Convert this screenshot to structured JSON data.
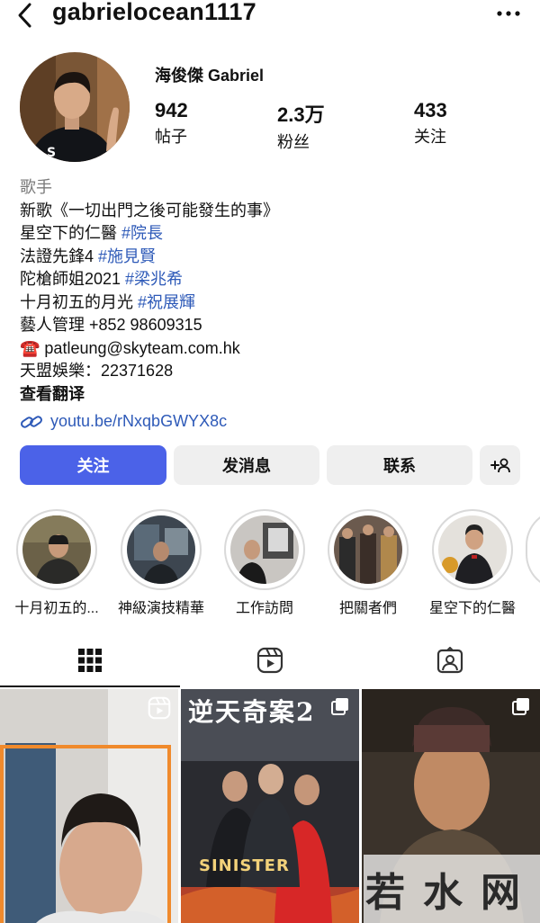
{
  "header": {
    "username": "gabrielocean1117",
    "back_icon": "chevron-left-icon",
    "more_icon": "more-horizontal-icon"
  },
  "profile": {
    "display_name": "海俊傑 Gabriel",
    "stats": [
      {
        "value": "942",
        "label": "帖子"
      },
      {
        "value": "2.3万",
        "label": "粉丝"
      },
      {
        "value": "433",
        "label": "关注"
      }
    ]
  },
  "bio": {
    "category": "歌手",
    "line1": "新歌《一切出門之後可能發生的事》",
    "line2_text": "星空下的仁醫 ",
    "line2_tag": "#院長",
    "line3_text": "法證先鋒4 ",
    "line3_tag": "#施見賢",
    "line4_text": "陀槍師姐2021 ",
    "line4_tag": "#梁兆希",
    "line5_text": "十月初五的月光 ",
    "line5_tag": "#祝展輝",
    "line6": "藝人管理 +852 98609315",
    "line7_emoji": "☎️",
    "line7_text": " patleung@skyteam.com.hk",
    "line8": "天盟娛樂：22371628",
    "translate": "查看翻译",
    "link": "youtu.be/rNxqbGWYX8c"
  },
  "actions": {
    "follow": "关注",
    "message": "发消息",
    "contact": "联系",
    "add_user_icon": "add-person-icon"
  },
  "highlights": [
    {
      "label": "十月初五的..."
    },
    {
      "label": "神級演技精華"
    },
    {
      "label": "工作訪問"
    },
    {
      "label": "把關者們"
    },
    {
      "label": "星空下的仁醫"
    }
  ],
  "tabs": {
    "grid_icon": "grid-icon",
    "reels_icon": "reels-icon",
    "tagged_icon": "tagged-icon"
  },
  "posts": [
    {
      "type": "reel"
    },
    {
      "type": "carousel",
      "text": "逆天奇案2",
      "subtitle": "SINISTER"
    },
    {
      "type": "carousel"
    }
  ],
  "watermark": "若水网",
  "colors": {
    "accent": "#4b62e8",
    "link": "#2e5ab8",
    "button_bg": "#efefef"
  }
}
